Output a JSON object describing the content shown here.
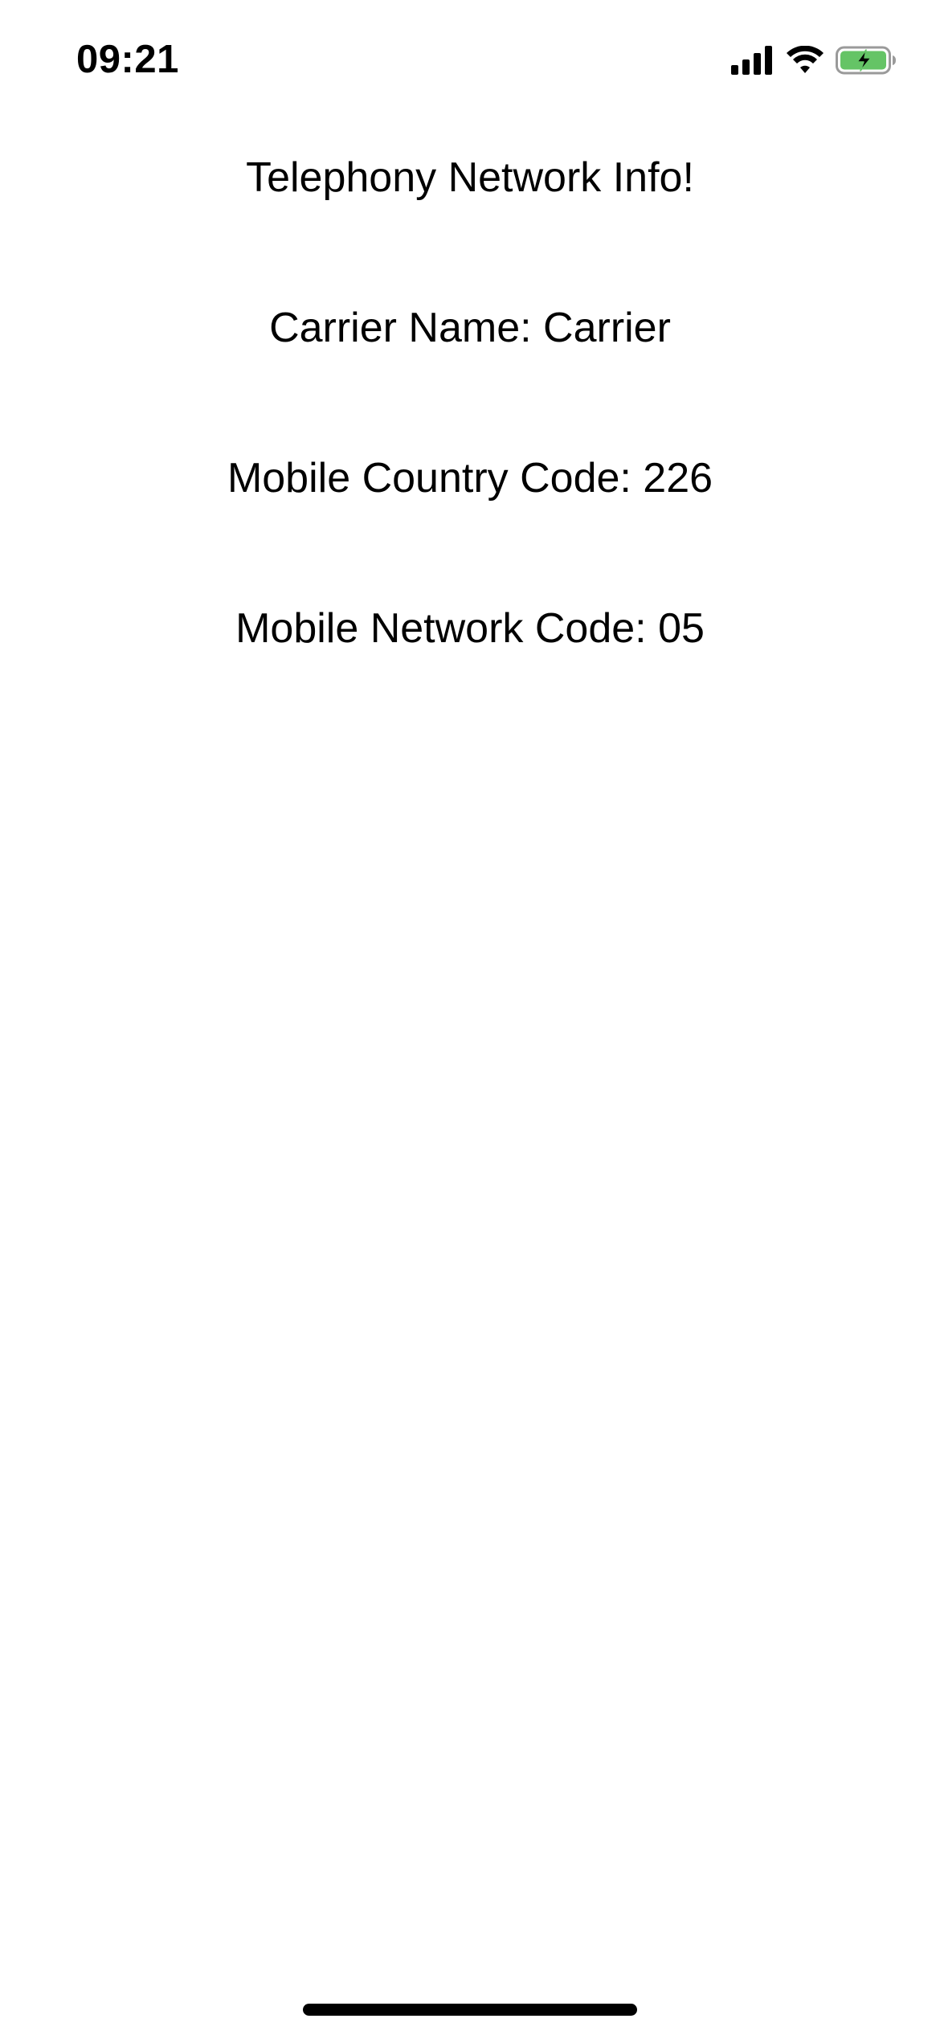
{
  "status_bar": {
    "time": "09:21",
    "icons": [
      "cellular-signal-icon",
      "wifi-icon",
      "battery-charging-icon"
    ],
    "battery_color": "#65c466"
  },
  "main": {
    "title": "Telephony Network Info!",
    "carrier_name": "Carrier Name: Carrier",
    "mobile_country_code": "Mobile Country Code: 226",
    "mobile_network_code": "Mobile Network Code: 05"
  }
}
